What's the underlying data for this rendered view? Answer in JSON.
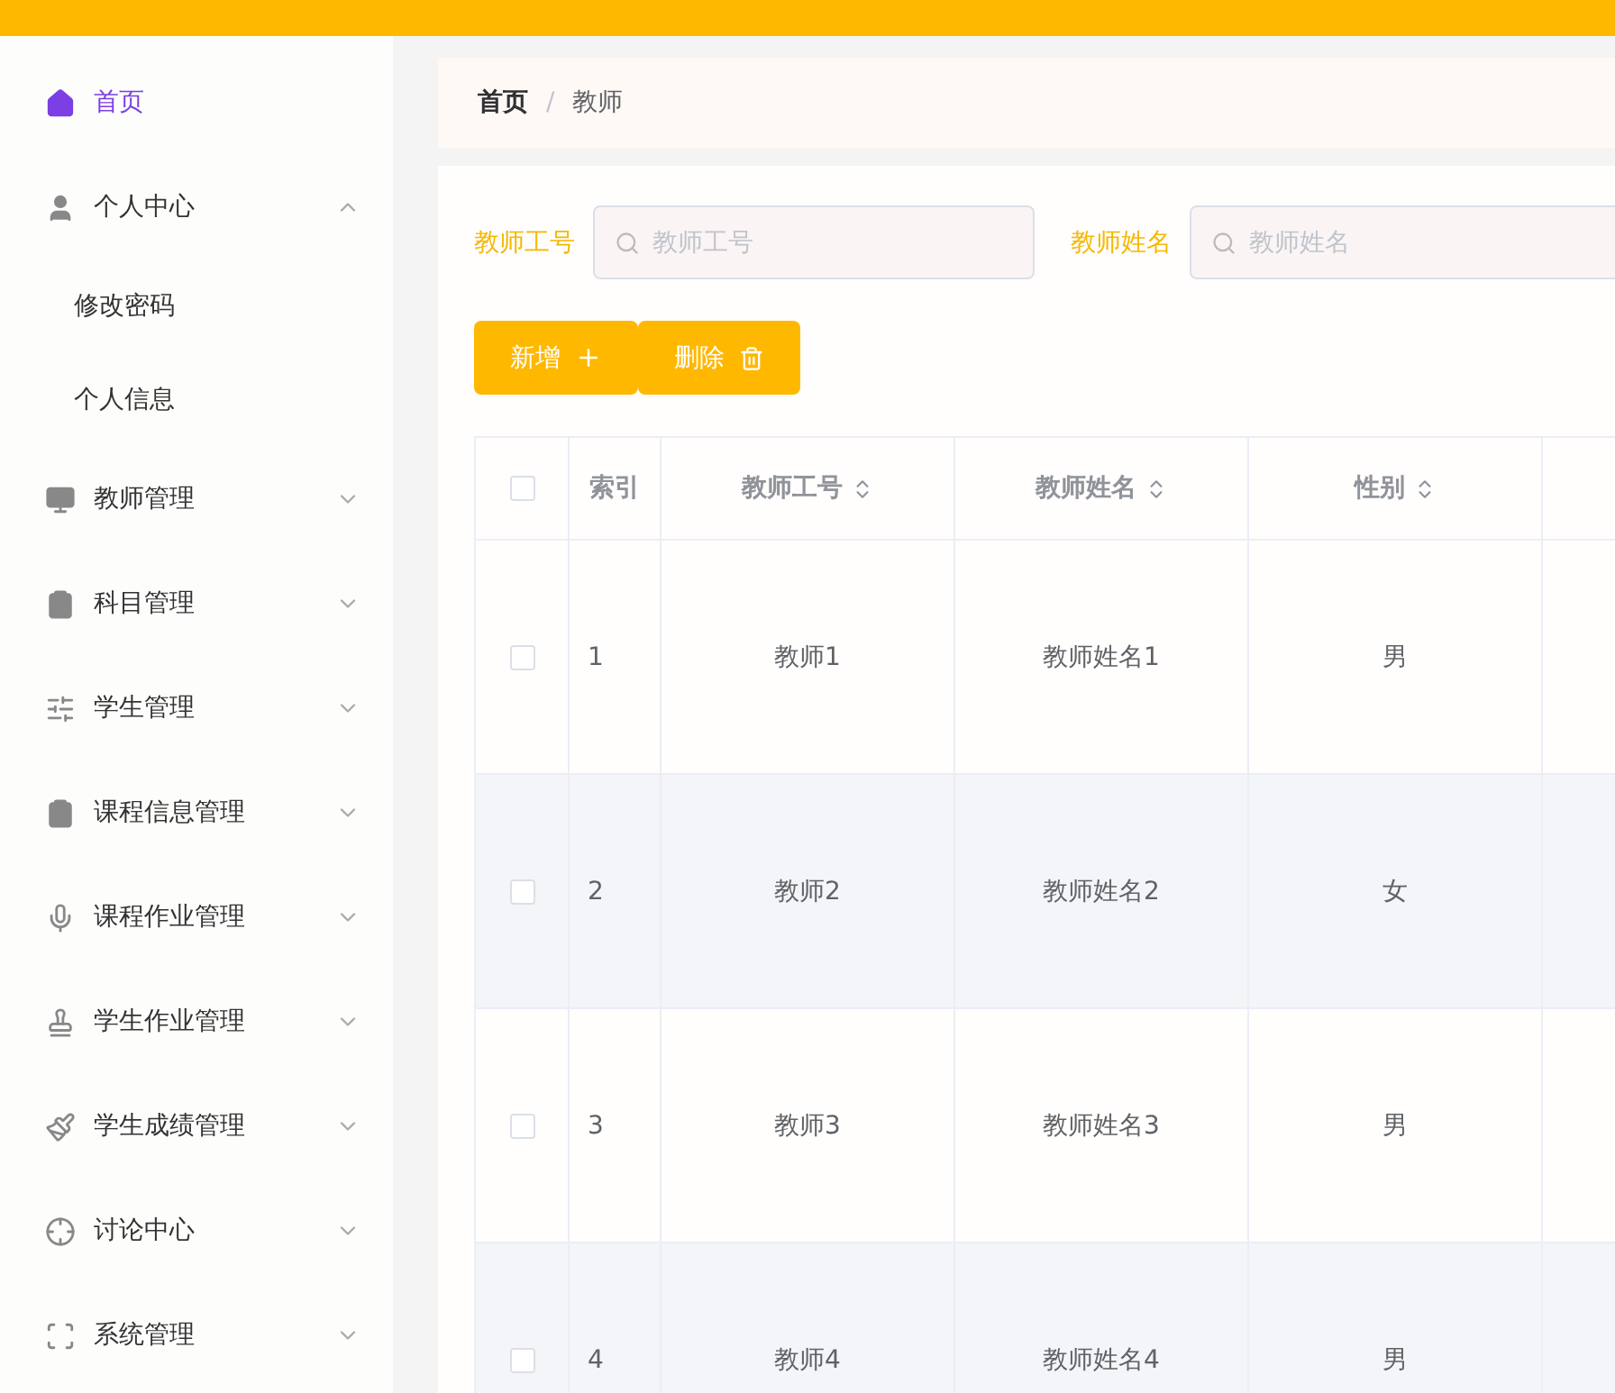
{
  "sidebar": {
    "items": [
      {
        "label": "首页",
        "selected": true
      },
      {
        "label": "个人中心",
        "selected": false,
        "expanded": true,
        "children": [
          {
            "label": "修改密码"
          },
          {
            "label": "个人信息"
          }
        ]
      },
      {
        "label": "教师管理",
        "selected": false,
        "expanded": false
      },
      {
        "label": "科目管理",
        "selected": false,
        "expanded": false
      },
      {
        "label": "学生管理",
        "selected": false,
        "expanded": false
      },
      {
        "label": "课程信息管理",
        "selected": false,
        "expanded": false
      },
      {
        "label": "课程作业管理",
        "selected": false,
        "expanded": false
      },
      {
        "label": "学生作业管理",
        "selected": false,
        "expanded": false
      },
      {
        "label": "学生成绩管理",
        "selected": false,
        "expanded": false
      },
      {
        "label": "讨论中心",
        "selected": false,
        "expanded": false
      },
      {
        "label": "系统管理",
        "selected": false,
        "expanded": false
      }
    ]
  },
  "breadcrumb": [
    "首页",
    "教师"
  ],
  "breadcrumb_separator": "/",
  "filters": [
    {
      "label": "教师工号",
      "placeholder": "教师工号"
    },
    {
      "label": "教师姓名",
      "placeholder": "教师姓名"
    }
  ],
  "buttons": [
    {
      "label": "新增",
      "kind": "add"
    },
    {
      "label": "删除",
      "kind": "delete"
    }
  ],
  "table": {
    "select_all_checked": false,
    "columns": [
      {
        "label": "索引",
        "sortable": false
      },
      {
        "label": "教师工号",
        "sortable": true
      },
      {
        "label": "教师姓名",
        "sortable": true
      },
      {
        "label": "性别",
        "sortable": true
      }
    ],
    "rows": [
      {
        "checked": false,
        "cells": [
          "1",
          "教师1",
          "教师姓名1",
          "男"
        ]
      },
      {
        "checked": false,
        "cells": [
          "2",
          "教师2",
          "教师姓名2",
          "女"
        ]
      },
      {
        "checked": false,
        "cells": [
          "3",
          "教师3",
          "教师姓名3",
          "男"
        ]
      },
      {
        "checked": false,
        "cells": [
          "4",
          "教师4",
          "教师姓名4",
          "男"
        ]
      }
    ]
  }
}
